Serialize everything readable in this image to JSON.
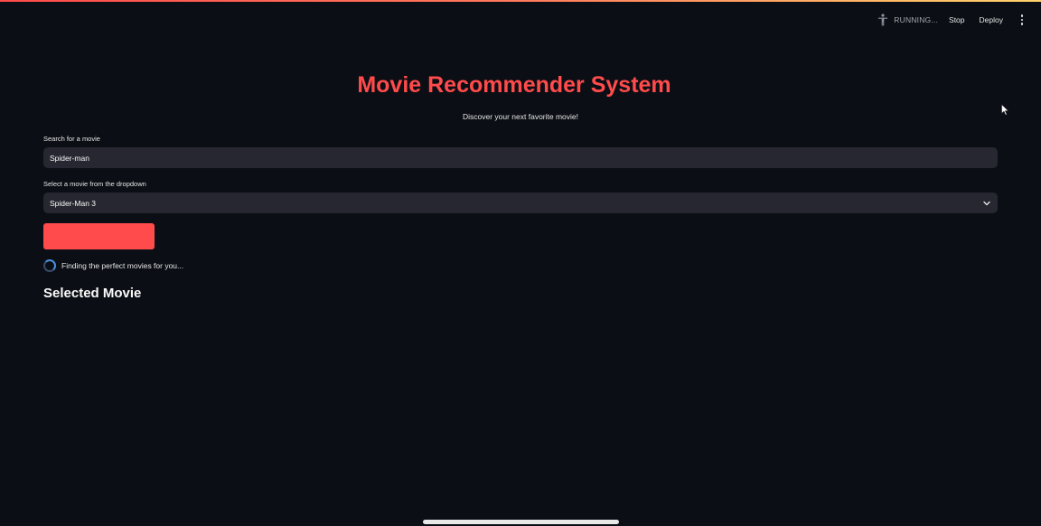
{
  "header": {
    "status_text": "RUNNING...",
    "stop_label": "Stop",
    "deploy_label": "Deploy",
    "status_icon": "running-figure-icon",
    "menu_icon": "kebab-menu-icon"
  },
  "main": {
    "title": "Movie Recommender System",
    "subtitle": "Discover your next favorite movie!",
    "search": {
      "label": "Search for a movie",
      "value": "Spider-man"
    },
    "select": {
      "label": "Select a movie from the dropdown",
      "selected": "Spider-Man 3"
    },
    "spinner_text": "Finding the perfect movies for you...",
    "section_heading": "Selected Movie"
  },
  "colors": {
    "background": "#0b0e14",
    "accent": "#ff4b4b",
    "input_bg": "#262730",
    "spinner": "#4a90e2"
  }
}
